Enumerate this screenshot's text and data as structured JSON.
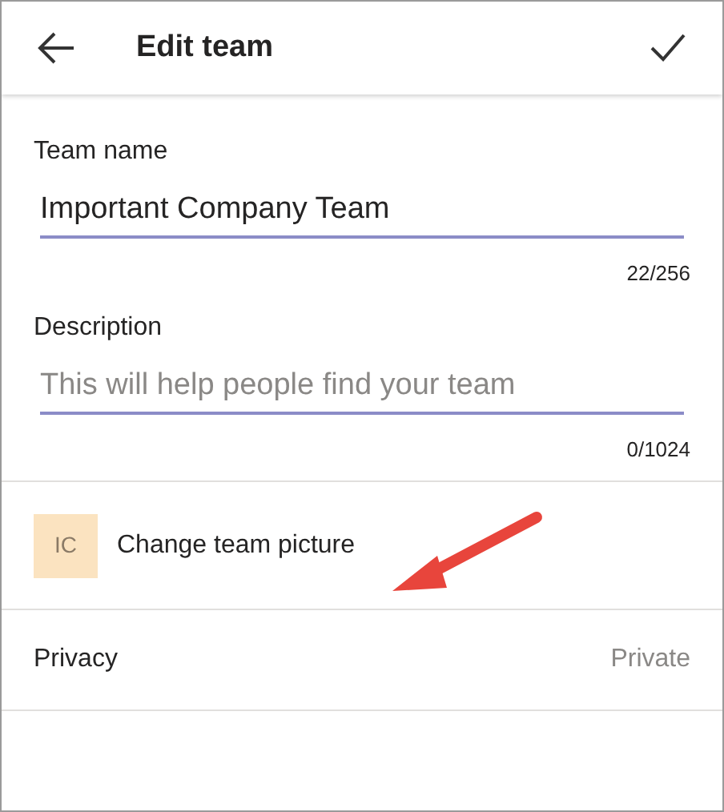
{
  "header": {
    "title": "Edit team"
  },
  "fields": [
    {
      "label": "Team name",
      "value": "Important Company Team",
      "counter": "22/256"
    },
    {
      "label": "Description",
      "placeholder": "This will help people find your team",
      "counter": "0/1024"
    }
  ],
  "picture_row": {
    "initials": "IC",
    "label": "Change team picture"
  },
  "privacy": {
    "label": "Privacy",
    "value": "Private"
  }
}
